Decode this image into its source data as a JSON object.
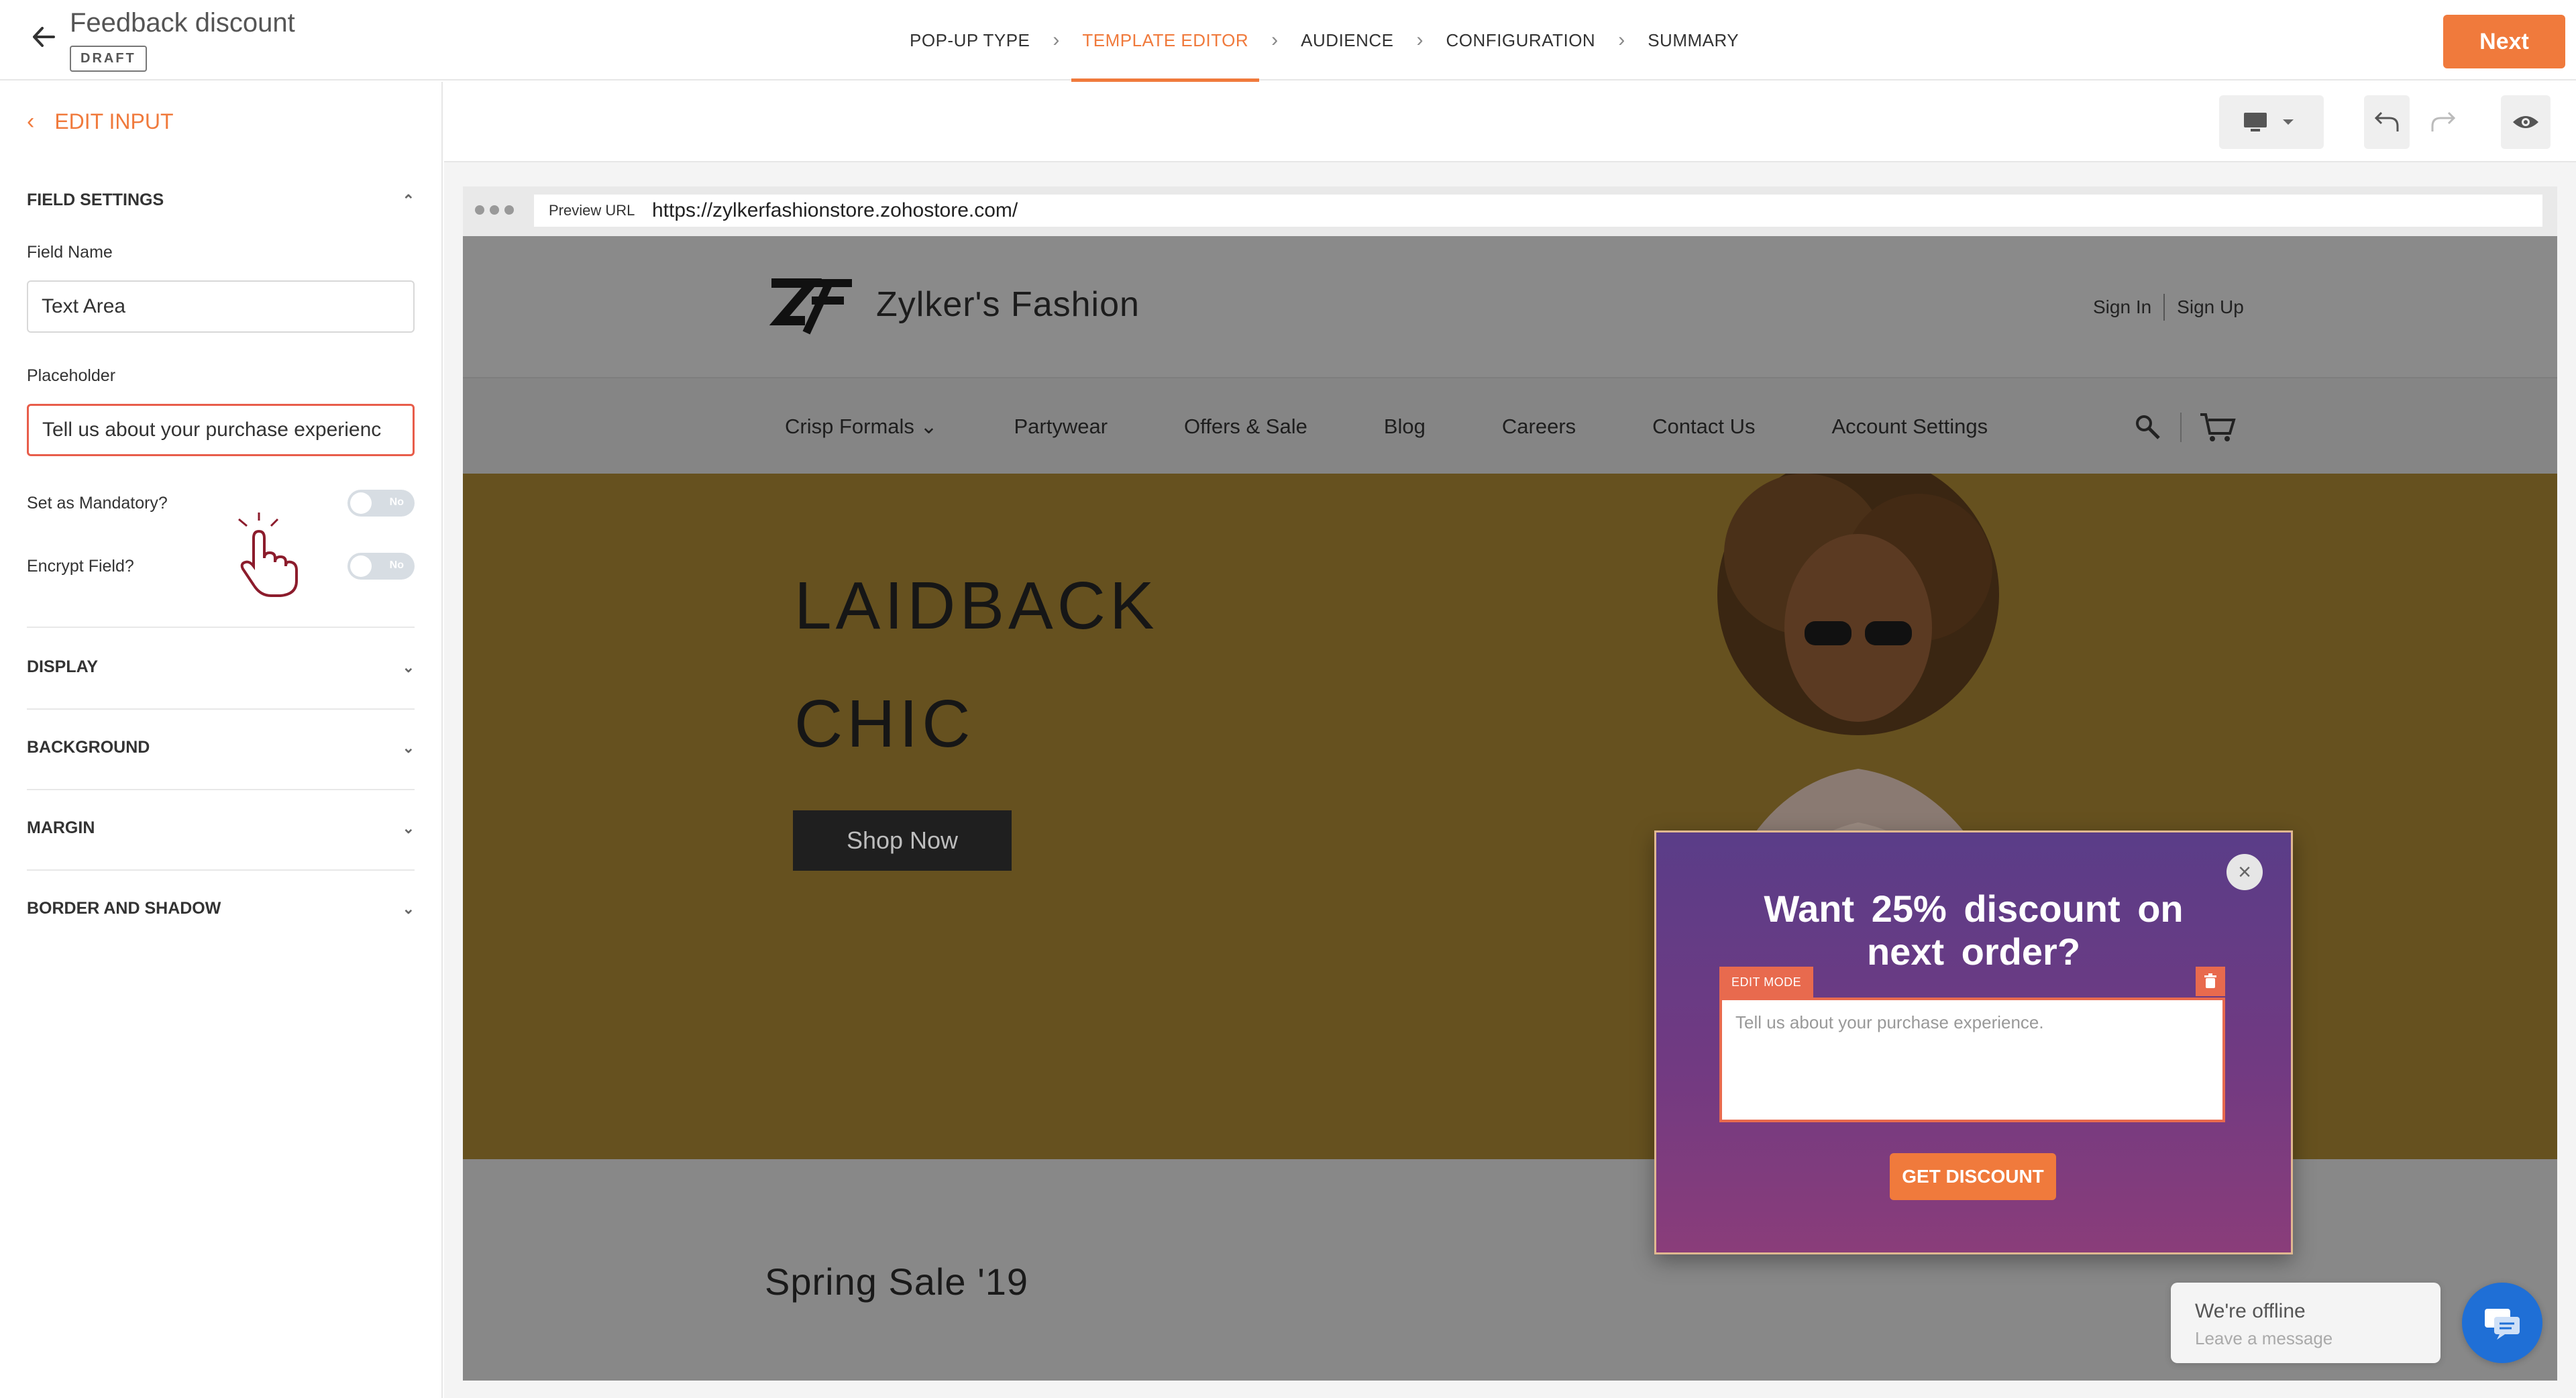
{
  "header": {
    "title": "Feedback discount",
    "status_badge": "DRAFT",
    "steps": [
      {
        "label": "POP-UP TYPE"
      },
      {
        "label": "TEMPLATE EDITOR"
      },
      {
        "label": "AUDIENCE"
      },
      {
        "label": "CONFIGURATION"
      },
      {
        "label": "SUMMARY"
      }
    ],
    "active_step": "TEMPLATE EDITOR",
    "next_label": "Next"
  },
  "left_panel": {
    "back_label": "EDIT INPUT",
    "field_settings": {
      "heading": "FIELD SETTINGS",
      "field_name_label": "Field Name",
      "field_name_value": "Text Area",
      "placeholder_label": "Placeholder",
      "placeholder_value": "Tell us about your purchase experienc",
      "mandatory_label": "Set as Mandatory?",
      "mandatory_toggle": "No",
      "encrypt_label": "Encrypt Field?",
      "encrypt_toggle": "No"
    },
    "sections": [
      {
        "label": "DISPLAY"
      },
      {
        "label": "BACKGROUND"
      },
      {
        "label": "MARGIN"
      },
      {
        "label": "BORDER AND SHADOW"
      }
    ]
  },
  "canvas": {
    "preview_url_label": "Preview URL",
    "url": "https://zylkerfashionstore.zohostore.com/",
    "site": {
      "brand": "Zylker's Fashion",
      "sign_in": "Sign In",
      "sign_up": "Sign Up",
      "nav": [
        "Crisp Formals ⌄",
        "Partywear",
        "Offers & Sale",
        "Blog",
        "Careers",
        "Contact Us",
        "Account Settings"
      ],
      "hero_line1": "LAIDBACK",
      "hero_line2": "CHIC",
      "shop_now": "Shop Now",
      "sale_title": "Spring Sale '19"
    },
    "popup": {
      "title_line1": "Want  25%  discount  on",
      "title_line2": "next  order?",
      "edit_mode_tag": "EDIT MODE",
      "textarea_placeholder": "Tell us about your purchase experience.",
      "button_label": "GET DISCOUNT"
    }
  },
  "chat": {
    "status": "We're offline",
    "prompt": "Leave a message"
  },
  "colors": {
    "accent": "#f07a3c",
    "edit_red": "#e86a4e",
    "popup_top": "#5a3d88",
    "popup_bottom": "#8a3d7a",
    "chat_blue": "#1f6fd6"
  }
}
